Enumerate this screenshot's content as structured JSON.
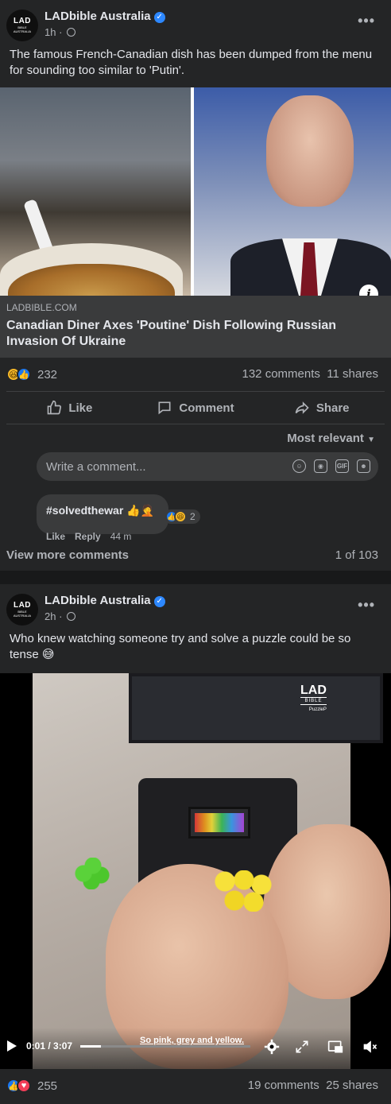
{
  "post1": {
    "page_name": "LADbible Australia",
    "avatar": {
      "main": "LAD",
      "sub": "BIBLE",
      "region": "AUSTRALIA"
    },
    "time": "1h",
    "meta_sep": "·",
    "text": "The famous French-Canadian dish has been dumped from the menu for sounding too similar to 'Putin'.",
    "link": {
      "domain": "LADBIBLE.COM",
      "title": "Canadian Diner Axes 'Poutine' Dish Following Russian Invasion Of Ukraine"
    },
    "reactions": {
      "count": "232",
      "types": [
        "haha",
        "like"
      ]
    },
    "comments_count": "132 comments",
    "shares_count": "11 shares",
    "actions": {
      "like": "Like",
      "comment": "Comment",
      "share": "Share"
    },
    "sort_label": "Most relevant",
    "comment_placeholder": "Write a comment...",
    "comment": {
      "text": "#solvedthewar 👍🤦",
      "reaction_count": "2",
      "like": "Like",
      "reply": "Reply",
      "time": "44 m"
    },
    "view_more": "View more comments",
    "pager": "1 of 103"
  },
  "post2": {
    "page_name": "LADbible Australia",
    "avatar": {
      "main": "LAD",
      "sub": "BIBLE",
      "region": "AUSTRALIA"
    },
    "time": "2h",
    "meta_sep": "·",
    "text": "Who knew watching someone try and solve a puzzle could be so tense 😅",
    "video": {
      "watermark_main": "LAD",
      "watermark_sub": "BIBLE",
      "watermark_tag": "PuzzleP",
      "time": "0:01 / 3:07",
      "progress": 0.005,
      "caption": "So pink, grey and yellow."
    },
    "reactions": {
      "count": "255",
      "types": [
        "like",
        "love"
      ]
    },
    "comments_count": "19 comments",
    "shares_count": "25 shares"
  },
  "colors": {
    "background": "#18191a",
    "card": "#242526",
    "input": "#3a3b3c",
    "text": "#e4e6eb",
    "secondary_text": "#b0b3b8",
    "like_blue": "#1877f2",
    "love_red": "#f33e58",
    "haha_yellow": "#f7b928",
    "verified_blue": "#2d88ff"
  },
  "icons": [
    "verified-badge-icon",
    "globe-icon",
    "more-options-icon",
    "info-icon",
    "like-icon",
    "comment-icon",
    "share-icon",
    "chevron-down-icon",
    "emoji-icon",
    "camera-icon",
    "gif-icon",
    "sticker-icon",
    "play-icon",
    "settings-icon",
    "fullscreen-icon",
    "miniplayer-icon",
    "mute-icon"
  ]
}
